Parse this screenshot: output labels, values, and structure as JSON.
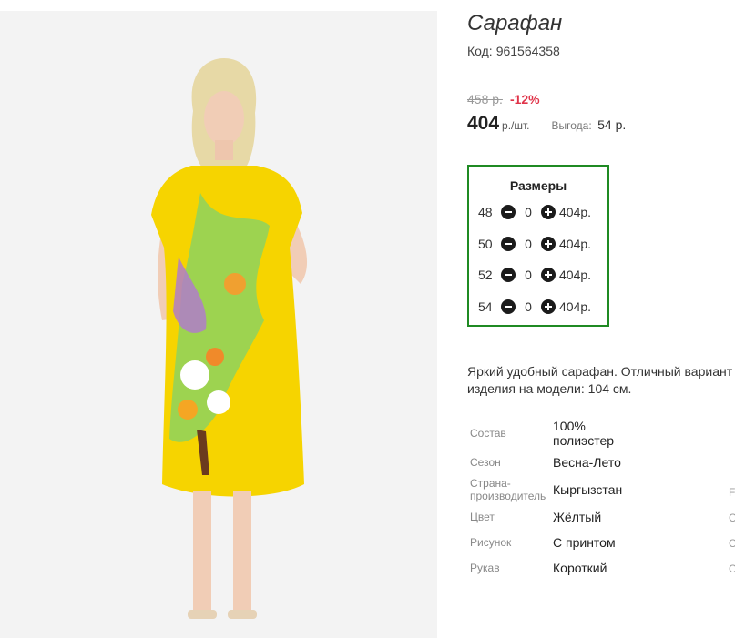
{
  "product": {
    "title": "Сарафан",
    "code_label": "Код:",
    "code": "961564358",
    "old_price": "458 р.",
    "discount": "-12%",
    "price": "404",
    "price_unit": "р./шт.",
    "benefit_label": "Выгода:",
    "benefit_value": "54 р.",
    "sizes": {
      "title": "Размеры",
      "rows": [
        {
          "size": "48",
          "qty": "0",
          "price": "404р."
        },
        {
          "size": "50",
          "qty": "0",
          "price": "404р."
        },
        {
          "size": "52",
          "qty": "0",
          "price": "404р."
        },
        {
          "size": "54",
          "qty": "0",
          "price": "404р."
        }
      ]
    },
    "description": [
      "Яркий удобный сарафан. Отличный вариант",
      "изделия на модели: 104 см."
    ],
    "specs": [
      {
        "label": "Состав",
        "value": "100% полиэстер"
      },
      {
        "label": "Сезон",
        "value": "Весна-Лето"
      },
      {
        "label": "Страна-производитель",
        "value": "Кыргызстан"
      },
      {
        "label": "Цвет",
        "value": "Жёлтый"
      },
      {
        "label": "Рисунок",
        "value": "С принтом"
      },
      {
        "label": "Рукав",
        "value": "Короткий"
      }
    ],
    "spec_ghost_letters": [
      "F",
      "C",
      "C",
      "C"
    ]
  },
  "colors": {
    "accent_border": "#1f8a23",
    "discount": "#e0344a",
    "dress": "#f6d400"
  },
  "icons": {
    "minus": "minus-circle-icon",
    "plus": "plus-circle-icon"
  }
}
